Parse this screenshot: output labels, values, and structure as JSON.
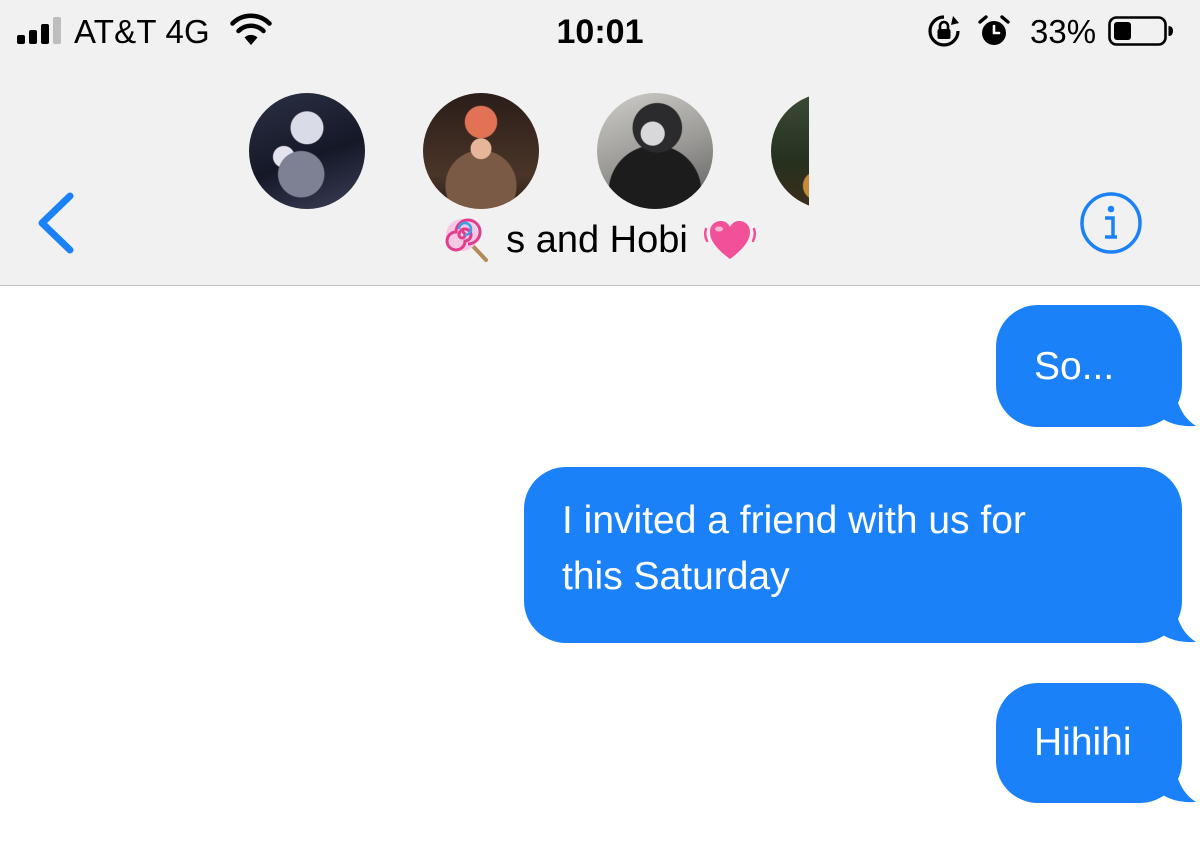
{
  "status_bar": {
    "carrier": "AT&T 4G",
    "time": "10:01",
    "battery_percent": "33%",
    "icons": [
      "signal-icon",
      "wifi-icon",
      "rotation-lock-icon",
      "alarm-icon",
      "battery-icon"
    ]
  },
  "conversation": {
    "title": "s and Hobi",
    "title_prefix_icon": "lollipop-emoji",
    "title_suffix_icon": "beating-heart-emoji",
    "avatars_count_visible": 4
  },
  "nav": {
    "back_icon": "chevron-left-icon",
    "info_icon": "info-icon",
    "accent_color": "#1b81f8"
  },
  "messages": [
    {
      "direction": "outgoing",
      "text": "So..."
    },
    {
      "direction": "outgoing",
      "text": "I invited a friend with us for\nthis Saturday"
    },
    {
      "direction": "outgoing",
      "text": "Hihihi"
    }
  ],
  "colors": {
    "bubble_outgoing": "#1b81f8",
    "header_background": "#f1f1f1",
    "background": "#ffffff"
  }
}
